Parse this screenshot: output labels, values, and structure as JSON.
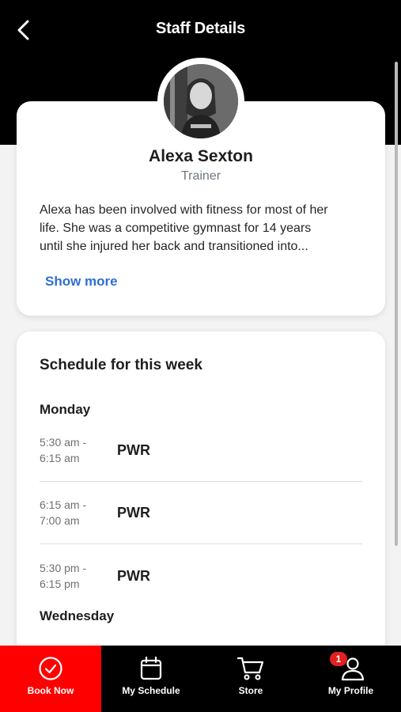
{
  "header": {
    "title": "Staff Details"
  },
  "profile": {
    "name": "Alexa Sexton",
    "role": "Trainer",
    "bio_lines": [
      "Alexa has been involved with fitness for most of her",
      "life. She was a competitive gymnast for 14 years",
      "until she injured her back and transitioned into..."
    ],
    "show_more_label": "Show more"
  },
  "schedule": {
    "title": "Schedule for this week",
    "days": [
      {
        "name": "Monday",
        "slots": [
          {
            "start": "5:30 am -",
            "end": "6:15 am",
            "class": "PWR"
          },
          {
            "start": "6:15 am -",
            "end": "7:00 am",
            "class": "PWR"
          },
          {
            "start": "5:30 pm -",
            "end": "6:15 pm",
            "class": "PWR"
          }
        ]
      },
      {
        "name": "Wednesday",
        "slots": []
      }
    ]
  },
  "tabbar": {
    "items": [
      {
        "label": "Book Now",
        "icon": "check-circle-icon",
        "active": true
      },
      {
        "label": "My Schedule",
        "icon": "calendar-icon",
        "active": false
      },
      {
        "label": "Store",
        "icon": "cart-icon",
        "active": false
      },
      {
        "label": "My Profile",
        "icon": "user-icon",
        "active": false,
        "badge": "1"
      }
    ],
    "active_color": "#ff0000"
  },
  "colors": {
    "header_bg": "#000000",
    "link": "#2f6fd0",
    "accent": "#ff0000"
  }
}
